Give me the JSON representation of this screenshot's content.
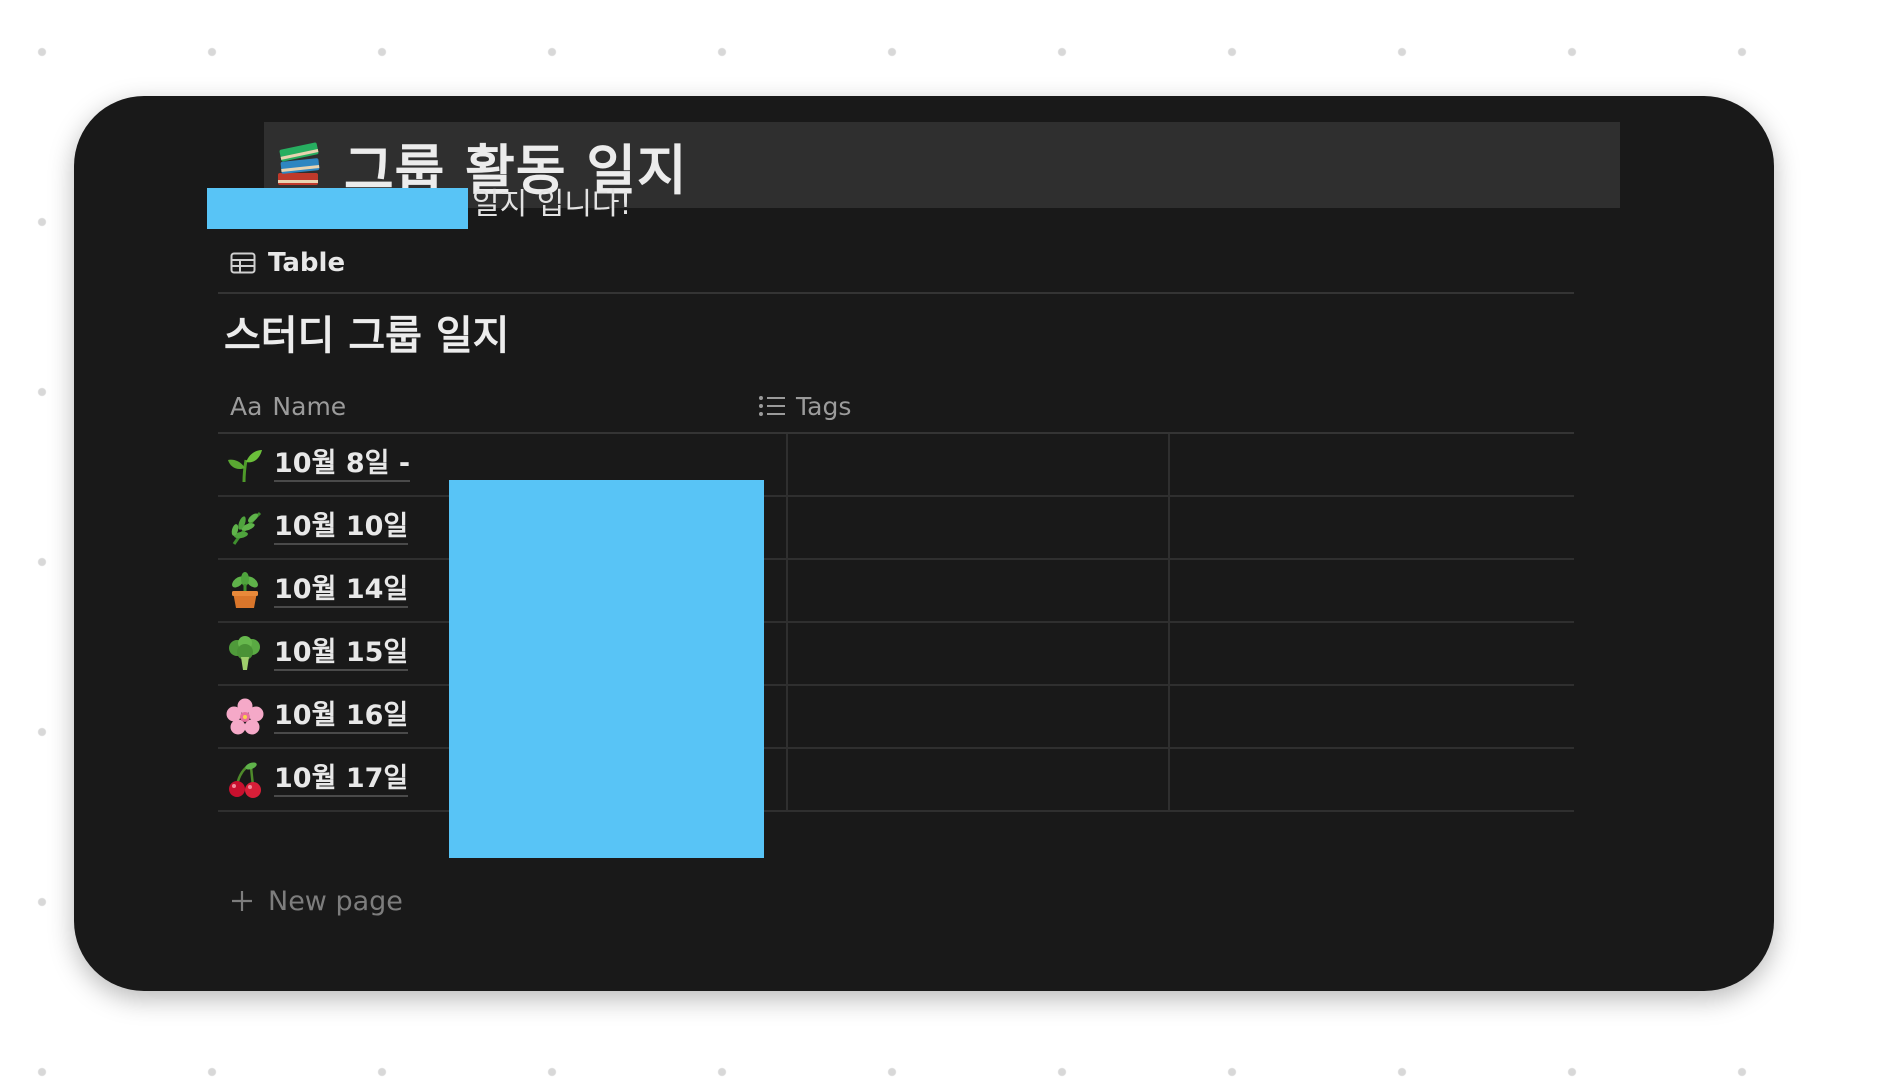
{
  "page": {
    "title": "그룹 활동 일지",
    "title_icon": "books-icon",
    "description": "일지 입니다!"
  },
  "view": {
    "tab_label": "Table",
    "tab_icon": "table-icon"
  },
  "database": {
    "title": "스터디 그룹 일지",
    "columns": [
      {
        "icon": "Aa",
        "label": "Name"
      },
      {
        "icon": "list-icon",
        "label": "Tags"
      }
    ],
    "rows": [
      {
        "icon": "seedling-icon",
        "name": "10월 8일 -"
      },
      {
        "icon": "herb-icon",
        "name": "10월 10일"
      },
      {
        "icon": "potted-plant-icon",
        "name": "10월 14일"
      },
      {
        "icon": "broccoli-icon",
        "name": "10월 15일"
      },
      {
        "icon": "cherry-blossom-icon",
        "name": "10월 16일"
      },
      {
        "icon": "cherries-icon",
        "name": "10월 17일"
      }
    ],
    "new_page_label": "New page"
  },
  "colors": {
    "background": "#191919",
    "title_bar": "#2f2f2f",
    "redaction": "#58c4f6",
    "text": "#e8e8e8",
    "muted_text": "#9b9b9b"
  }
}
